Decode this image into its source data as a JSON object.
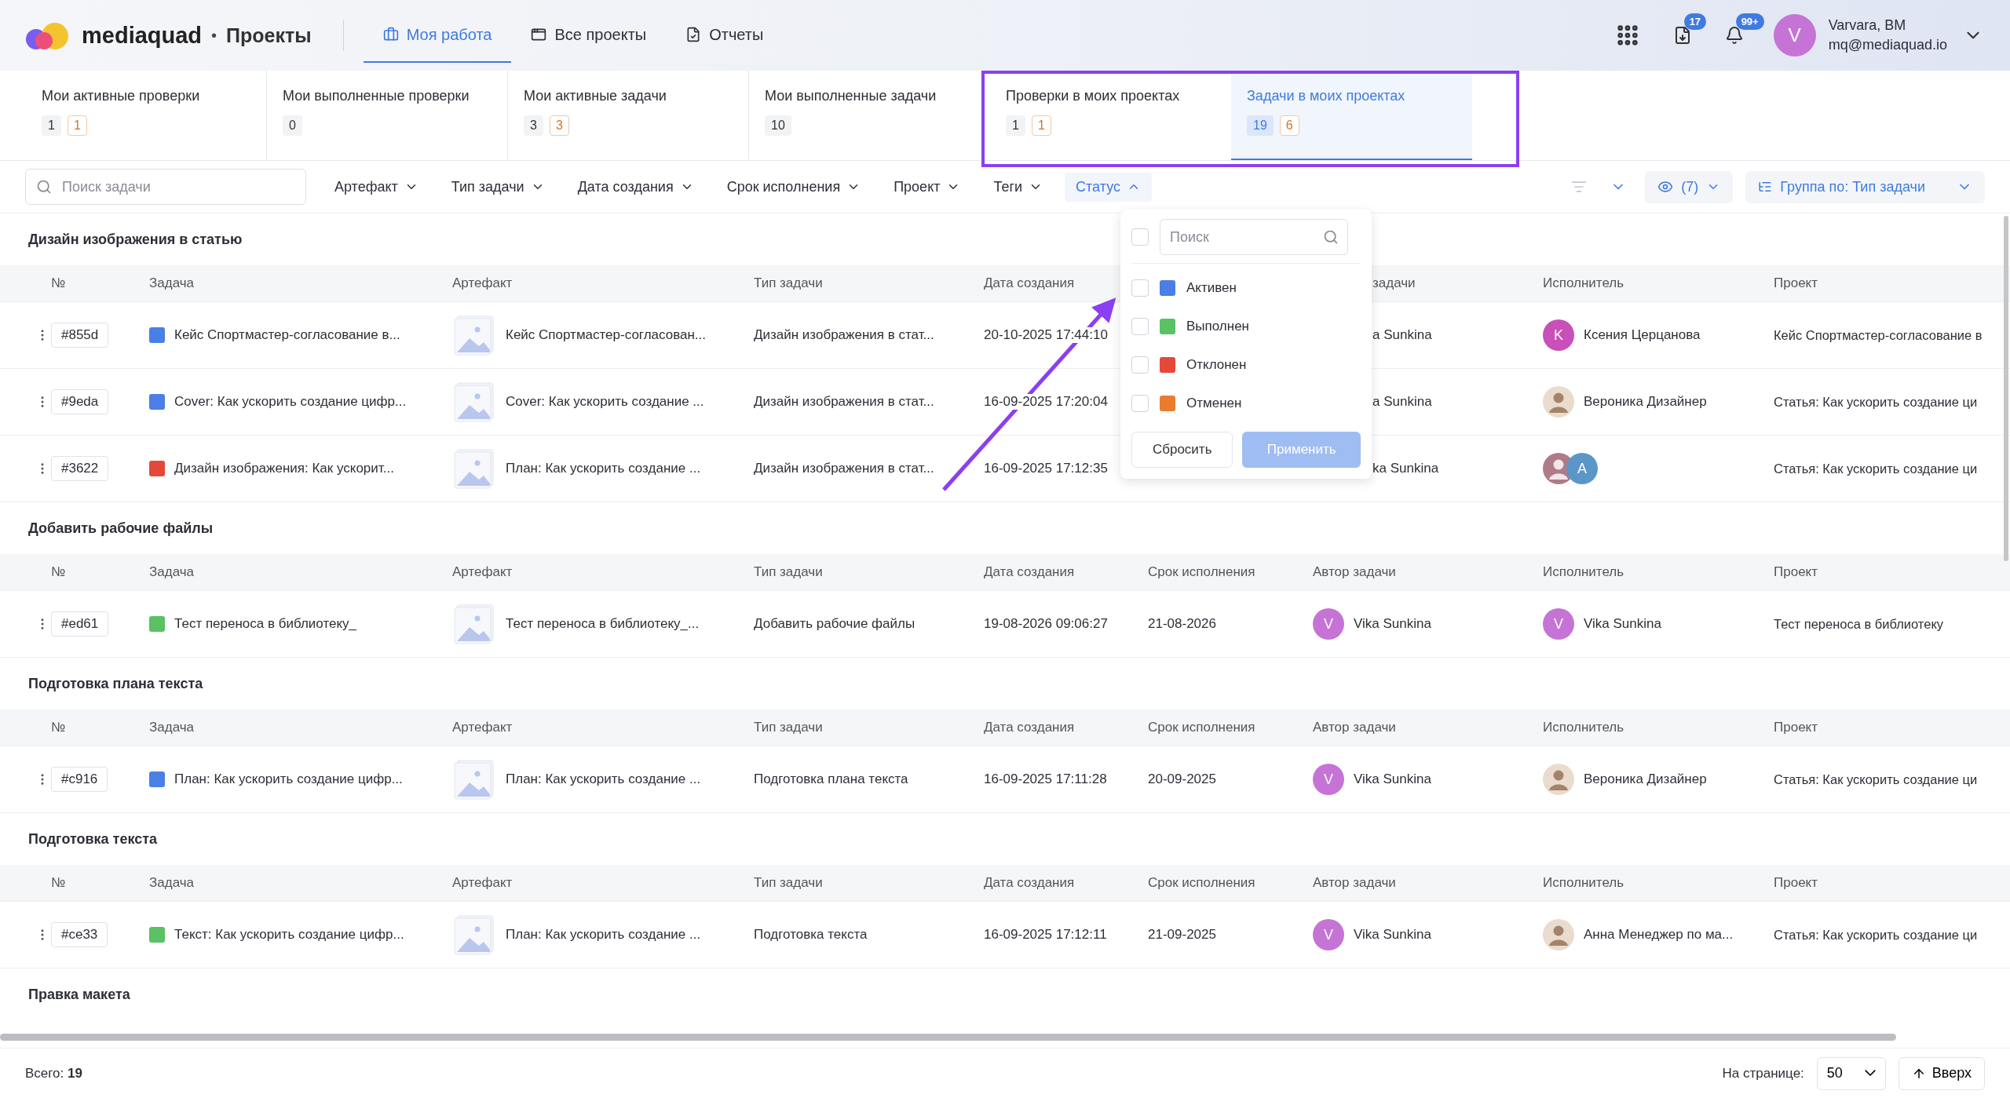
{
  "app": {
    "brand": "mediaquad",
    "separator": "•",
    "section": "Проекты"
  },
  "nav": [
    {
      "label": "Моя работа",
      "selected": true
    },
    {
      "label": "Все проекты",
      "selected": false
    },
    {
      "label": "Отчеты",
      "selected": false
    }
  ],
  "header_actions": {
    "downloads_badge": "17",
    "notifications_badge": "99+"
  },
  "user": {
    "initial": "V",
    "name": "Varvara, BM",
    "email": "mq@mediaquad.io"
  },
  "stats": [
    {
      "label": "Мои активные проверки",
      "counts": [
        {
          "value": "1",
          "kind": "plain"
        },
        {
          "value": "1",
          "kind": "warning"
        }
      ],
      "selected": false
    },
    {
      "label": "Мои выполненные проверки",
      "counts": [
        {
          "value": "0",
          "kind": "plain"
        }
      ],
      "selected": false
    },
    {
      "label": "Мои активные задачи",
      "counts": [
        {
          "value": "3",
          "kind": "plain"
        },
        {
          "value": "3",
          "kind": "warning"
        }
      ],
      "selected": false
    },
    {
      "label": "Мои выполненные задачи",
      "counts": [
        {
          "value": "10",
          "kind": "plain"
        }
      ],
      "selected": false
    },
    {
      "label": "Проверки в моих проектах",
      "counts": [
        {
          "value": "1",
          "kind": "plain"
        },
        {
          "value": "1",
          "kind": "warning"
        }
      ],
      "selected": false
    },
    {
      "label": "Задачи в моих проектах",
      "counts": [
        {
          "value": "19",
          "kind": "plain"
        },
        {
          "value": "6",
          "kind": "warning"
        }
      ],
      "selected": true
    }
  ],
  "filters": {
    "search_placeholder": "Поиск задачи",
    "items": [
      {
        "label": "Артефакт",
        "open": false
      },
      {
        "label": "Тип задачи",
        "open": false
      },
      {
        "label": "Дата создания",
        "open": false
      },
      {
        "label": "Срок исполнения",
        "open": false
      },
      {
        "label": "Проект",
        "open": false
      },
      {
        "label": "Теги",
        "open": false
      },
      {
        "label": "Статус",
        "open": true
      }
    ],
    "visible_columns": "(7)",
    "group_by": "Группа по: Тип задачи"
  },
  "status_menu": {
    "search_placeholder": "Поиск",
    "all_checked": false,
    "options": [
      {
        "label": "Активен",
        "color": "#4a7fe6",
        "checked": false
      },
      {
        "label": "Выполнен",
        "color": "#5ac165",
        "checked": false
      },
      {
        "label": "Отклонен",
        "color": "#e5483a",
        "checked": false
      },
      {
        "label": "Отменен",
        "color": "#ea7c30",
        "checked": false
      }
    ],
    "reset": "Сбросить",
    "apply": "Применить",
    "apply_disabled": true
  },
  "groups": [
    {
      "title": "Дизайн изображения в статью",
      "columns": [
        {
          "label": "№"
        },
        {
          "label": "Задача"
        },
        {
          "label": "Артефакт"
        },
        {
          "label": "Тип задачи"
        },
        {
          "label": "Дата создания"
        },
        null,
        {
          "label": "задачи",
          "covered": true
        },
        {
          "label": "Исполнитель"
        },
        {
          "label": "Проект"
        }
      ],
      "rows": [
        {
          "id": "#855d",
          "color": "#4a7fe6",
          "task": "Кейс Спортмастер-согласование в...",
          "artifact": "Кейс Спортмастер-согласован...",
          "type": "Дизайн изображения в стат...",
          "created": "20-10-2025 17:44:10",
          "due": null,
          "author": {
            "name": "a Sunkina",
            "kind": "covered"
          },
          "assignee": {
            "name": "Ксения Церцанова",
            "kind": "letter",
            "initial": "K",
            "color": "#c94fb9"
          },
          "project": "Кейс Спортмастер-согласование в"
        },
        {
          "id": "#9eda",
          "color": "#4a7fe6",
          "task": "Cover: Как ускорить создание цифр...",
          "artifact": "Cover: Как ускорить создание ...",
          "type": "Дизайн изображения в стат...",
          "created": "16-09-2025 17:20:04",
          "due": null,
          "author": {
            "name": "a Sunkina",
            "kind": "covered"
          },
          "assignee": {
            "name": "Вероника Дизайнер",
            "kind": "photo"
          },
          "project": "Статья: Как ускорить создание ци"
        },
        {
          "id": "#3622",
          "color": "#e5483a",
          "task": "Дизайн изображения: Как ускорит...",
          "artifact": "План: Как ускорить создание ...",
          "type": "Дизайн изображения в стат...",
          "created": "16-09-2025 17:12:35",
          "due": null,
          "author": {
            "name": "ka Sunkina",
            "kind": "covered"
          },
          "assignee": {
            "kind": "pair",
            "initial": "A",
            "color": "#5b96c8"
          },
          "project": "Статья: Как ускорить создание ци"
        }
      ]
    },
    {
      "title": "Добавить рабочие файлы",
      "columns": [
        {
          "label": "№"
        },
        {
          "label": "Задача"
        },
        {
          "label": "Артефакт"
        },
        {
          "label": "Тип задачи"
        },
        {
          "label": "Дата создания"
        },
        {
          "label": "Срок исполнения"
        },
        {
          "label": "Автор задачи"
        },
        {
          "label": "Исполнитель"
        },
        {
          "label": "Проект"
        }
      ],
      "rows": [
        {
          "id": "#ed61",
          "color": "#5ac165",
          "task": "Тест переноса в библиотеку_",
          "artifact": "Тест переноса в библиотеку_...",
          "type": "Добавить рабочие файлы",
          "created": "19-08-2026 09:06:27",
          "due": "21-08-2026",
          "author": {
            "name": "Vika Sunkina",
            "kind": "letter",
            "initial": "V",
            "color": "#c574d6"
          },
          "assignee": {
            "name": "Vika Sunkina",
            "kind": "letter",
            "initial": "V",
            "color": "#c574d6"
          },
          "project": "Тест переноса в библиотеку"
        }
      ]
    },
    {
      "title": "Подготовка плана текста",
      "columns": [
        {
          "label": "№"
        },
        {
          "label": "Задача"
        },
        {
          "label": "Артефакт"
        },
        {
          "label": "Тип задачи"
        },
        {
          "label": "Дата создания"
        },
        {
          "label": "Срок исполнения"
        },
        {
          "label": "Автор задачи"
        },
        {
          "label": "Исполнитель"
        },
        {
          "label": "Проект"
        }
      ],
      "rows": [
        {
          "id": "#c916",
          "color": "#4a7fe6",
          "task": "План: Как ускорить создание цифр...",
          "artifact": "План: Как ускорить создание ...",
          "type": "Подготовка плана текста",
          "created": "16-09-2025 17:11:28",
          "due": "20-09-2025",
          "author": {
            "name": "Vika Sunkina",
            "kind": "letter",
            "initial": "V",
            "color": "#c574d6"
          },
          "assignee": {
            "name": "Вероника Дизайнер",
            "kind": "photo"
          },
          "project": "Статья: Как ускорить создание ци"
        }
      ]
    },
    {
      "title": "Подготовка текста",
      "columns": [
        {
          "label": "№"
        },
        {
          "label": "Задача"
        },
        {
          "label": "Артефакт"
        },
        {
          "label": "Тип задачи"
        },
        {
          "label": "Дата создания"
        },
        {
          "label": "Срок исполнения"
        },
        {
          "label": "Автор задачи"
        },
        {
          "label": "Исполнитель"
        },
        {
          "label": "Проект"
        }
      ],
      "rows": [
        {
          "id": "#ce33",
          "color": "#5ac165",
          "task": "Текст: Как ускорить создание цифр...",
          "artifact": "План: Как ускорить создание ...",
          "type": "Подготовка текста",
          "created": "16-09-2025 17:12:11",
          "due": "21-09-2025",
          "author": {
            "name": "Vika Sunkina",
            "kind": "letter",
            "initial": "V",
            "color": "#c574d6"
          },
          "assignee": {
            "name": "Анна Менеджер по ма...",
            "kind": "photo"
          },
          "project": "Статья: Как ускорить создание ци"
        }
      ]
    },
    {
      "title": "Правка макета"
    }
  ],
  "footer": {
    "total_label": "Всего: **19**",
    "per_page_label": "На странице:",
    "per_page": "50",
    "top_button": "Вверх"
  }
}
